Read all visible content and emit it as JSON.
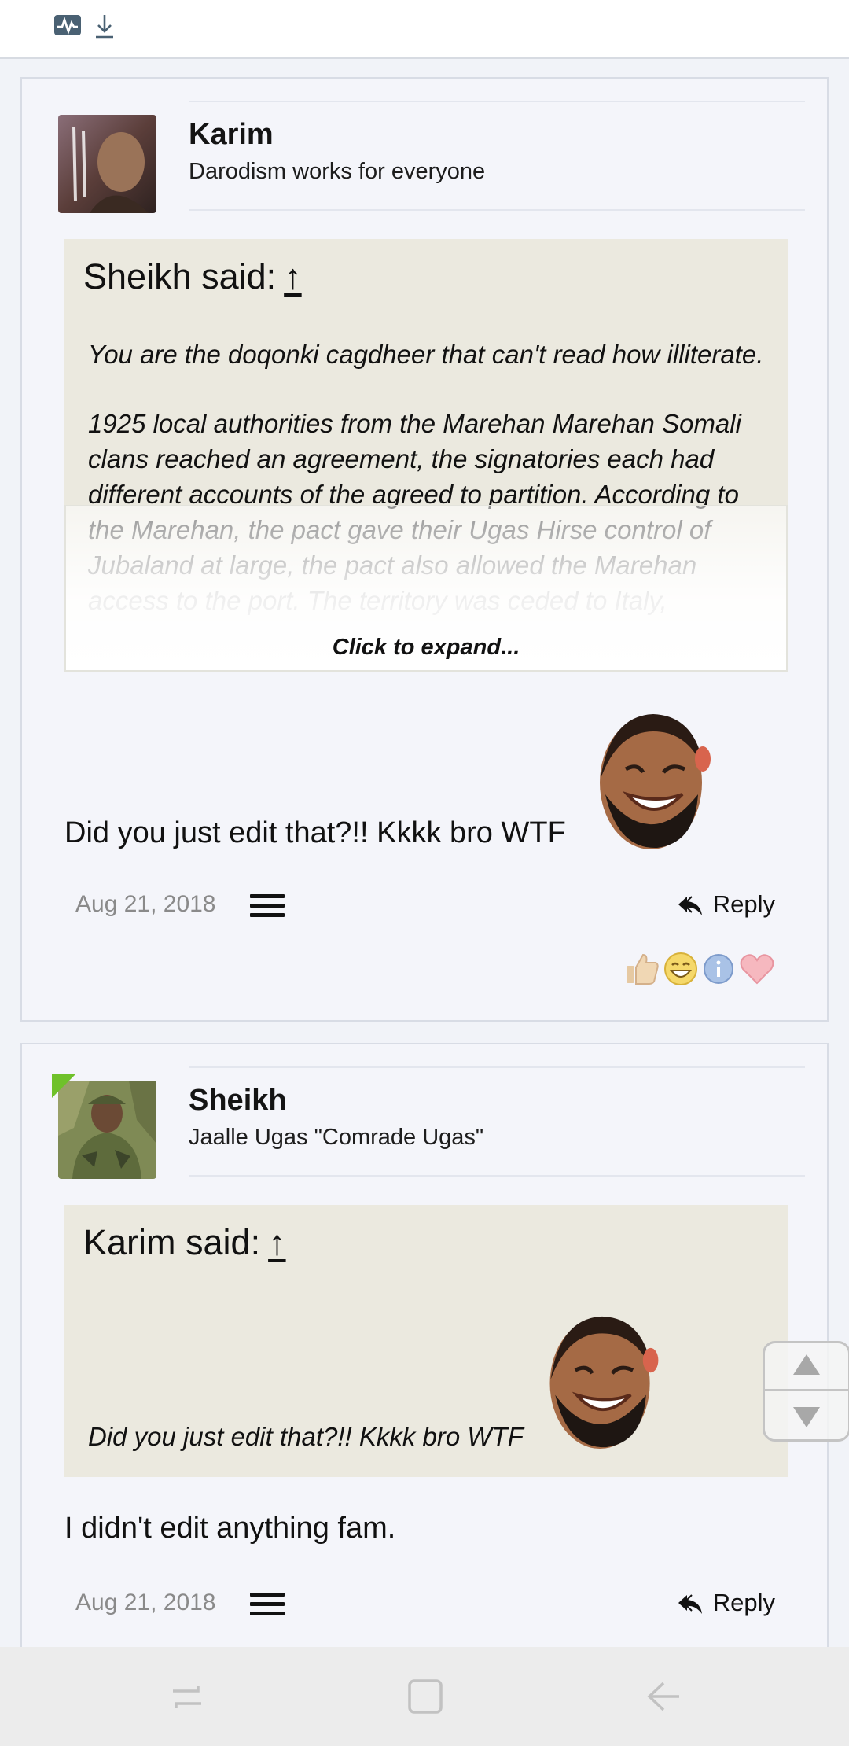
{
  "topbar": {
    "icons": [
      "activity-icon",
      "download-icon"
    ]
  },
  "posts": [
    {
      "username": "Karim",
      "user_title": "Darodism works for everyone",
      "quote": {
        "author_label": "Sheikh said:",
        "arrow": "↑",
        "paragraph1": "You are the doqonki cagdheer that can't read how illiterate.",
        "paragraph2": "1925 local authorities from the Marehan Marehan Somali clans reached an agreement, the signatories each had different accounts of the agreed to partition. According to the Marehan, the pact gave their Ugas Hirse control of Jubaland at large, the pact also allowed the Marehan access to the port. The territory was ceded to Italy,",
        "expand_label": "Click to expand..."
      },
      "message": "Did you just edit that?!! Kkkk bro WTF",
      "date": "Aug 21, 2018",
      "reply_label": "Reply",
      "reactions": [
        "like-icon",
        "haha-icon",
        "info-icon",
        "love-icon"
      ]
    },
    {
      "username": "Sheikh",
      "user_title": "Jaalle Ugas \"Comrade Ugas\"",
      "quote": {
        "author_label": "Karim said:",
        "arrow": "↑",
        "text": "Did you just edit that?!! Kkkk bro WTF"
      },
      "message": "I didn't edit anything fam.",
      "date": "Aug 21, 2018",
      "reply_label": "Reply"
    }
  ],
  "navbar": {
    "icons": [
      "recent-apps-icon",
      "home-icon",
      "back-icon"
    ]
  },
  "colors": {
    "quote_bg": "#ebe9df",
    "post_bg": "#f4f5fa",
    "online_badge": "#6fc12a"
  }
}
